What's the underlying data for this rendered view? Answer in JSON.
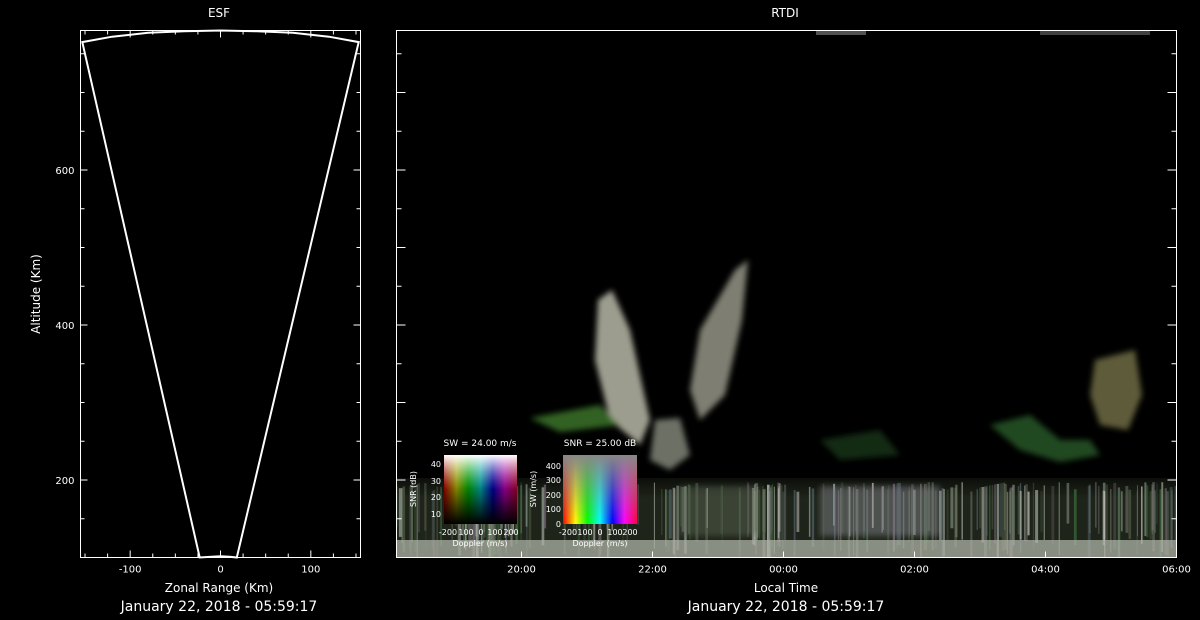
{
  "colors": {
    "background": "#000000",
    "foreground": "#ffffff"
  },
  "chart_data": [
    {
      "id": "esf",
      "type": "line",
      "title": "ESF",
      "xlabel": "Zonal Range (Km)",
      "ylabel": "Altitude (Km)",
      "xlim": [
        -155,
        155
      ],
      "ylim": [
        100,
        780
      ],
      "x_ticks": [
        -100,
        0,
        100
      ],
      "x_tick_labels": [
        "-100",
        "0",
        "100"
      ],
      "y_ticks": [
        200,
        400,
        600
      ],
      "y_tick_labels": [
        "200",
        "400",
        "600"
      ],
      "date_label": "January 22, 2018 - 05:59:17",
      "series": [
        {
          "x": [
            -23,
            -153,
            -120,
            -80,
            -40,
            0,
            40,
            80,
            120,
            153,
            18,
            10,
            0,
            -10,
            -23
          ],
          "y": [
            100,
            765,
            772,
            777,
            779,
            780,
            779,
            777,
            772,
            765,
            100,
            101,
            101.5,
            101,
            100
          ]
        }
      ]
    },
    {
      "id": "rtdi",
      "type": "heatmap",
      "title": "RTDI",
      "xlabel": "Local Time",
      "x_ticks": [
        "20:00",
        "22:00",
        "00:00",
        "02:00",
        "04:00",
        "06:00"
      ],
      "ylim": [
        100,
        780
      ],
      "date_label": "January 22, 2018 - 05:59:17",
      "legends": [
        {
          "title": "SW = 24.00 m/s",
          "xlabel": "Doppler (m/s)",
          "ylabel": "SNR (dB)",
          "x_tick_labels": [
            "-200",
            "100",
            "0",
            "100",
            "200"
          ],
          "y_tick_labels": [
            "40",
            "30",
            "20",
            "10"
          ]
        },
        {
          "title": "SNR = 25.00 dB",
          "xlabel": "Doppler (m/s)",
          "ylabel": "SW (m/s)",
          "x_tick_labels": [
            "-200",
            "100",
            "0",
            "100",
            "200"
          ],
          "y_tick_labels": [
            "400",
            "300",
            "200",
            "100",
            "0"
          ]
        }
      ]
    }
  ]
}
